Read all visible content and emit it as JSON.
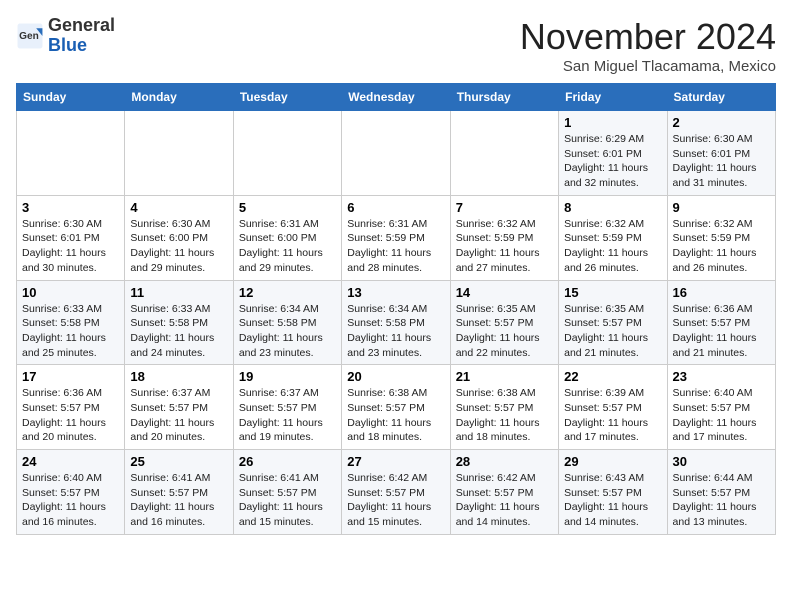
{
  "header": {
    "logo_general": "General",
    "logo_blue": "Blue",
    "month_title": "November 2024",
    "subtitle": "San Miguel Tlacamama, Mexico"
  },
  "weekdays": [
    "Sunday",
    "Monday",
    "Tuesday",
    "Wednesday",
    "Thursday",
    "Friday",
    "Saturday"
  ],
  "weeks": [
    [
      {
        "day": "",
        "info": ""
      },
      {
        "day": "",
        "info": ""
      },
      {
        "day": "",
        "info": ""
      },
      {
        "day": "",
        "info": ""
      },
      {
        "day": "",
        "info": ""
      },
      {
        "day": "1",
        "info": "Sunrise: 6:29 AM\nSunset: 6:01 PM\nDaylight: 11 hours and 32 minutes."
      },
      {
        "day": "2",
        "info": "Sunrise: 6:30 AM\nSunset: 6:01 PM\nDaylight: 11 hours and 31 minutes."
      }
    ],
    [
      {
        "day": "3",
        "info": "Sunrise: 6:30 AM\nSunset: 6:01 PM\nDaylight: 11 hours and 30 minutes."
      },
      {
        "day": "4",
        "info": "Sunrise: 6:30 AM\nSunset: 6:00 PM\nDaylight: 11 hours and 29 minutes."
      },
      {
        "day": "5",
        "info": "Sunrise: 6:31 AM\nSunset: 6:00 PM\nDaylight: 11 hours and 29 minutes."
      },
      {
        "day": "6",
        "info": "Sunrise: 6:31 AM\nSunset: 5:59 PM\nDaylight: 11 hours and 28 minutes."
      },
      {
        "day": "7",
        "info": "Sunrise: 6:32 AM\nSunset: 5:59 PM\nDaylight: 11 hours and 27 minutes."
      },
      {
        "day": "8",
        "info": "Sunrise: 6:32 AM\nSunset: 5:59 PM\nDaylight: 11 hours and 26 minutes."
      },
      {
        "day": "9",
        "info": "Sunrise: 6:32 AM\nSunset: 5:59 PM\nDaylight: 11 hours and 26 minutes."
      }
    ],
    [
      {
        "day": "10",
        "info": "Sunrise: 6:33 AM\nSunset: 5:58 PM\nDaylight: 11 hours and 25 minutes."
      },
      {
        "day": "11",
        "info": "Sunrise: 6:33 AM\nSunset: 5:58 PM\nDaylight: 11 hours and 24 minutes."
      },
      {
        "day": "12",
        "info": "Sunrise: 6:34 AM\nSunset: 5:58 PM\nDaylight: 11 hours and 23 minutes."
      },
      {
        "day": "13",
        "info": "Sunrise: 6:34 AM\nSunset: 5:58 PM\nDaylight: 11 hours and 23 minutes."
      },
      {
        "day": "14",
        "info": "Sunrise: 6:35 AM\nSunset: 5:57 PM\nDaylight: 11 hours and 22 minutes."
      },
      {
        "day": "15",
        "info": "Sunrise: 6:35 AM\nSunset: 5:57 PM\nDaylight: 11 hours and 21 minutes."
      },
      {
        "day": "16",
        "info": "Sunrise: 6:36 AM\nSunset: 5:57 PM\nDaylight: 11 hours and 21 minutes."
      }
    ],
    [
      {
        "day": "17",
        "info": "Sunrise: 6:36 AM\nSunset: 5:57 PM\nDaylight: 11 hours and 20 minutes."
      },
      {
        "day": "18",
        "info": "Sunrise: 6:37 AM\nSunset: 5:57 PM\nDaylight: 11 hours and 20 minutes."
      },
      {
        "day": "19",
        "info": "Sunrise: 6:37 AM\nSunset: 5:57 PM\nDaylight: 11 hours and 19 minutes."
      },
      {
        "day": "20",
        "info": "Sunrise: 6:38 AM\nSunset: 5:57 PM\nDaylight: 11 hours and 18 minutes."
      },
      {
        "day": "21",
        "info": "Sunrise: 6:38 AM\nSunset: 5:57 PM\nDaylight: 11 hours and 18 minutes."
      },
      {
        "day": "22",
        "info": "Sunrise: 6:39 AM\nSunset: 5:57 PM\nDaylight: 11 hours and 17 minutes."
      },
      {
        "day": "23",
        "info": "Sunrise: 6:40 AM\nSunset: 5:57 PM\nDaylight: 11 hours and 17 minutes."
      }
    ],
    [
      {
        "day": "24",
        "info": "Sunrise: 6:40 AM\nSunset: 5:57 PM\nDaylight: 11 hours and 16 minutes."
      },
      {
        "day": "25",
        "info": "Sunrise: 6:41 AM\nSunset: 5:57 PM\nDaylight: 11 hours and 16 minutes."
      },
      {
        "day": "26",
        "info": "Sunrise: 6:41 AM\nSunset: 5:57 PM\nDaylight: 11 hours and 15 minutes."
      },
      {
        "day": "27",
        "info": "Sunrise: 6:42 AM\nSunset: 5:57 PM\nDaylight: 11 hours and 15 minutes."
      },
      {
        "day": "28",
        "info": "Sunrise: 6:42 AM\nSunset: 5:57 PM\nDaylight: 11 hours and 14 minutes."
      },
      {
        "day": "29",
        "info": "Sunrise: 6:43 AM\nSunset: 5:57 PM\nDaylight: 11 hours and 14 minutes."
      },
      {
        "day": "30",
        "info": "Sunrise: 6:44 AM\nSunset: 5:57 PM\nDaylight: 11 hours and 13 minutes."
      }
    ]
  ]
}
